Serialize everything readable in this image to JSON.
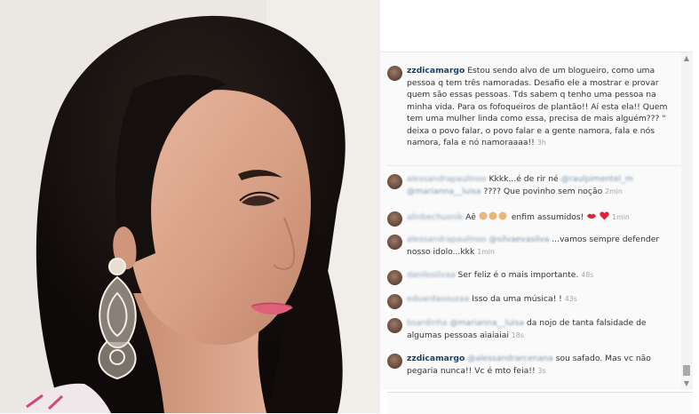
{
  "caption": {
    "username": "zzdicamargo",
    "text": "Estou sendo alvo de um blogueiro, como uma pessoa q tem três namoradas. Desafio ele a mostrar e provar quem são essas pessoas. Tds sabem q tenho uma pessoa na minha vida. Para os fofoqueiros de plantão!! Aí esta ela!! Quem tem uma mulher linda como essa, precisa de mais alguém??? \" deixa o povo falar, o povo falar e a gente namora, fala e nós namora, fala e nó namoraaaa!!",
    "time": "3h"
  },
  "comments": [
    {
      "username": "alessandrapaulinoo",
      "pre": "Kkkk...é de rir né",
      "mention": "@raulpimentel_m",
      "mention2": "@marianna__luisa",
      "post": "???? Que povinho sem noção",
      "time": "2min"
    },
    {
      "username": "alinbechusnik",
      "pre": "Aê",
      "post": "enfim assumidos!",
      "time": "1min"
    },
    {
      "username": "alessandrapaulinoo",
      "mention": "@silvaevasilva",
      "post": "...vamos sempre defender nosso idolo...kkk",
      "time": "1min"
    },
    {
      "username": "danilosilvaa",
      "post": "Ser feliz é o mais importante.",
      "time": "48s"
    },
    {
      "username": "eduardasouzaa",
      "post": "Isso da uma música! !",
      "time": "43s"
    },
    {
      "username": "bsardinha",
      "mention": "@marianna__luisa",
      "post": "da nojo de tanta falsidade de algumas pessoas aiaiaiai",
      "time": "18s"
    },
    {
      "username": "zzdicamargo",
      "mention": "@alessandrarcenana",
      "post": "sou safado. Mas vc não pegaria nunca!! Vc é mto feia!!",
      "time": "3s"
    }
  ],
  "icons": {
    "scroll_up": "triangle-up-icon",
    "scroll_down": "triangle-down-icon",
    "clap": "clapping-hands-icon",
    "kiss": "kiss-lips-icon",
    "heart": "red-heart-icon"
  },
  "colors": {
    "username": "#12436e",
    "text": "#333333",
    "time": "#a5a5a5",
    "comment_bg": "#fafafa"
  }
}
